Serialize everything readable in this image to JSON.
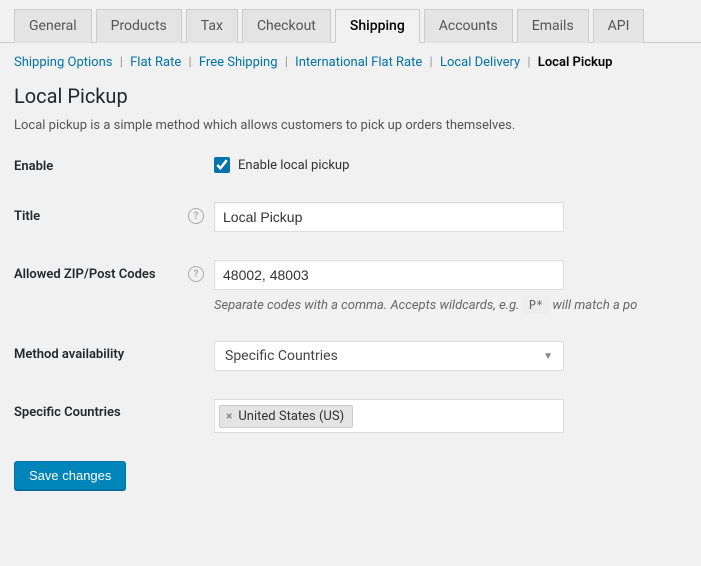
{
  "tabs": {
    "items": [
      {
        "label": "General",
        "active": false
      },
      {
        "label": "Products",
        "active": false
      },
      {
        "label": "Tax",
        "active": false
      },
      {
        "label": "Checkout",
        "active": false
      },
      {
        "label": "Shipping",
        "active": true
      },
      {
        "label": "Accounts",
        "active": false
      },
      {
        "label": "Emails",
        "active": false
      },
      {
        "label": "API",
        "active": false
      }
    ]
  },
  "subnav": {
    "items": [
      {
        "label": "Shipping Options",
        "current": false
      },
      {
        "label": "Flat Rate",
        "current": false
      },
      {
        "label": "Free Shipping",
        "current": false
      },
      {
        "label": "International Flat Rate",
        "current": false
      },
      {
        "label": "Local Delivery",
        "current": false
      },
      {
        "label": "Local Pickup",
        "current": true
      }
    ]
  },
  "page": {
    "heading": "Local Pickup",
    "description": "Local pickup is a simple method which allows customers to pick up orders themselves."
  },
  "form": {
    "enable": {
      "label": "Enable",
      "checkbox_label": "Enable local pickup",
      "checked": true
    },
    "title": {
      "label": "Title",
      "value": "Local Pickup"
    },
    "zip": {
      "label": "Allowed ZIP/Post Codes",
      "value": "48002, 48003",
      "help_pre": "Separate codes with a comma. Accepts wildcards, e.g. ",
      "help_code": "P*",
      "help_post": " will match all postcodes starting with P."
    },
    "availability": {
      "label": "Method availability",
      "value": "Specific Countries"
    },
    "countries": {
      "label": "Specific Countries",
      "selected": "United States (US)"
    },
    "save": "Save changes"
  }
}
